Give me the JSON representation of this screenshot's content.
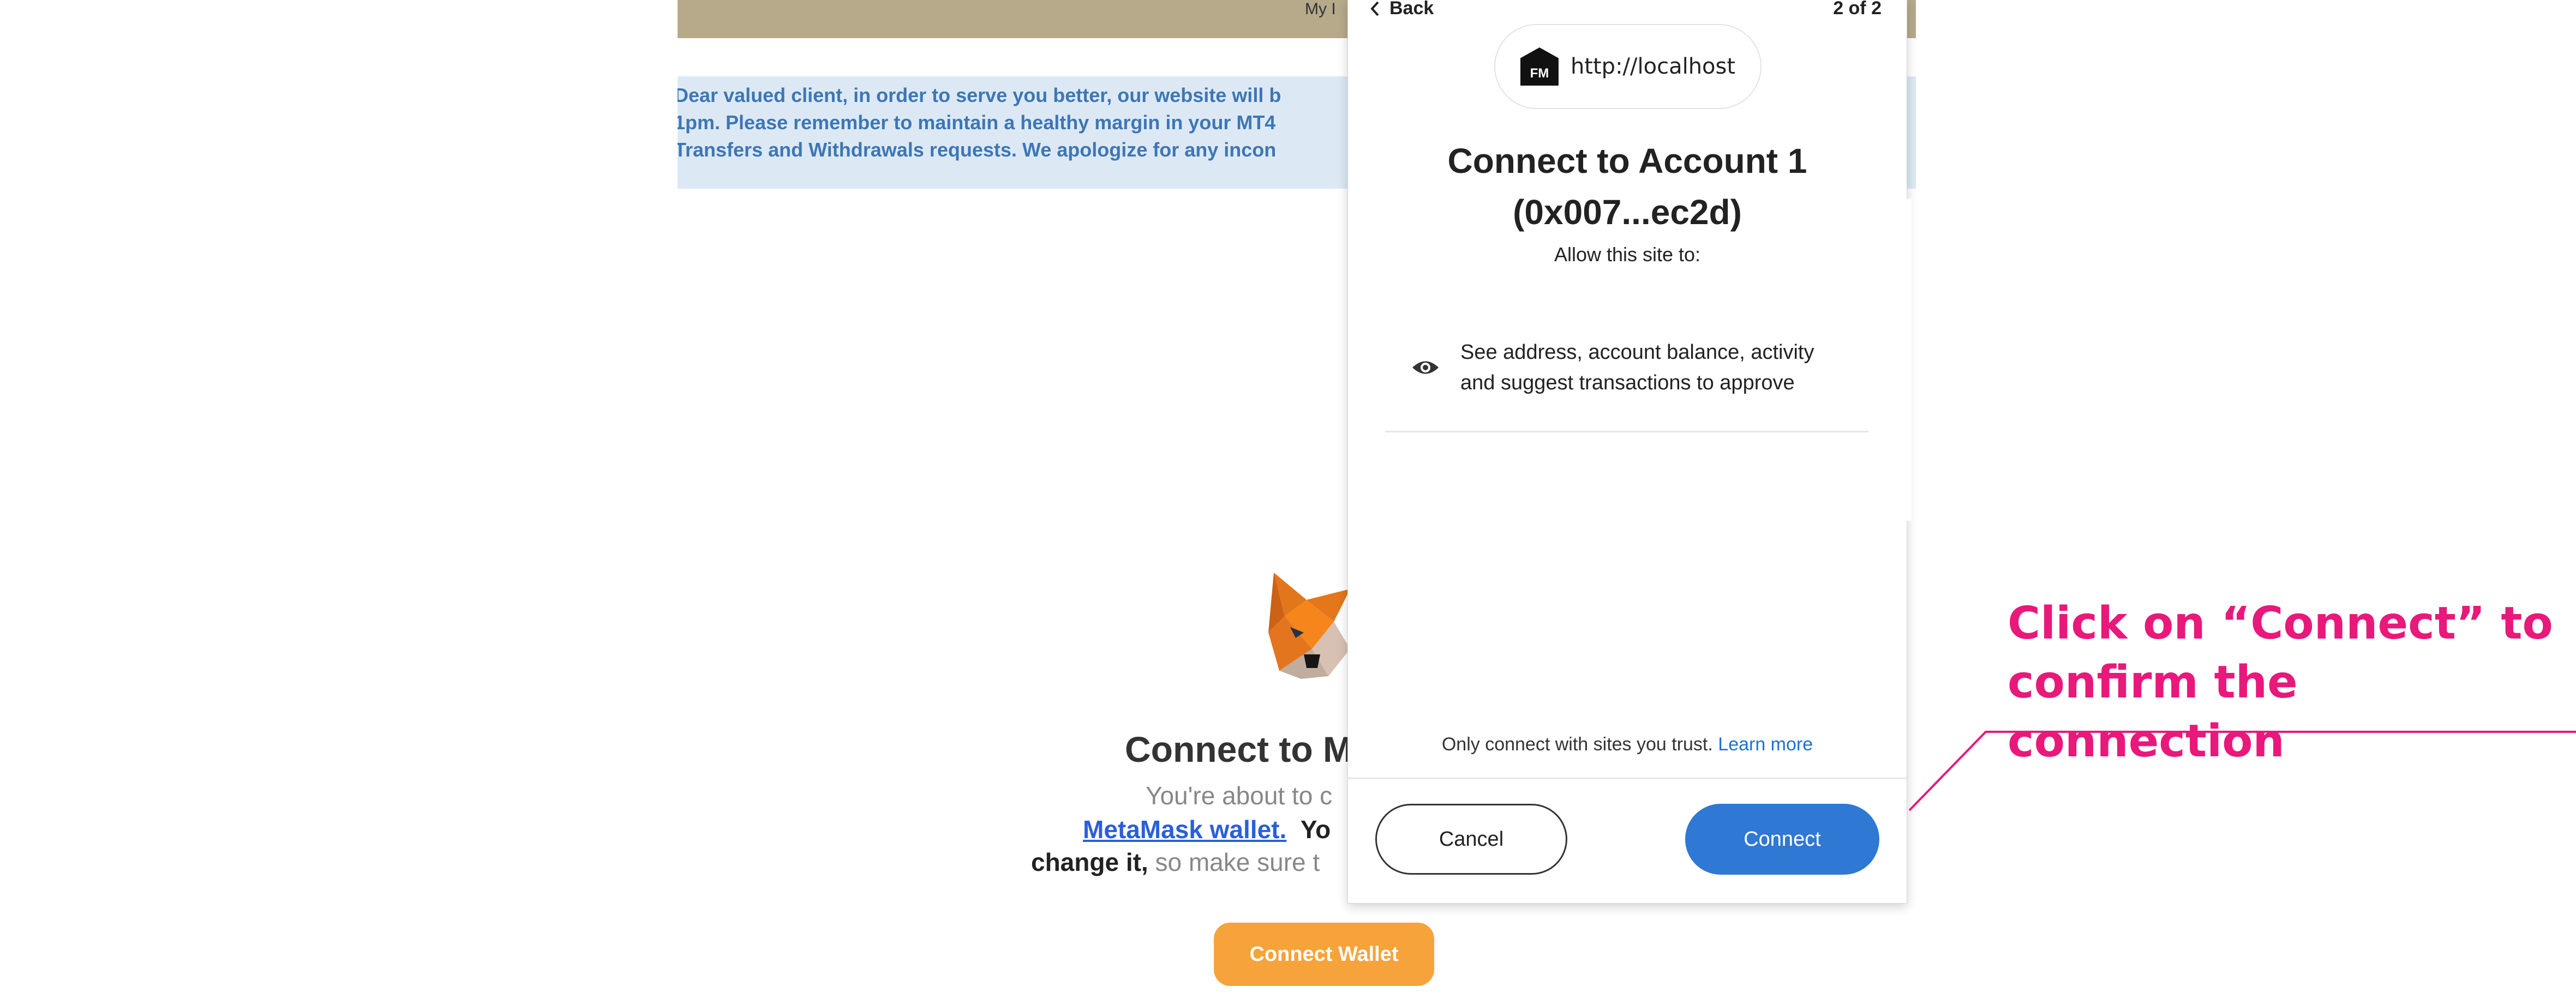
{
  "background_page": {
    "top_link": "My I",
    "notice_lines": [
      "Dear valued client, in order to serve you better, our website will b",
      "1pm. Please remember to maintain a healthy margin in your MT4",
      "Transfers and Withdrawals requests. We apologize for any incon"
    ],
    "heading": "Connect to M",
    "line1": "You're about to c",
    "line2_link": "MetaMask wallet.",
    "line2_bold": "Yo",
    "line3_bold": "change it,",
    "line3_rest": "so make sure t",
    "connect_wallet_label": "Connect Wallet"
  },
  "popup": {
    "back_label": "Back",
    "step": "2 of 2",
    "origin_badge": "FM",
    "origin_url": "http://localhost",
    "title_line1": "Connect to Account 1",
    "title_line2": "(0x007...ec2d)",
    "allow_text": "Allow this site to:",
    "permission_line1": "See address, account balance, activity",
    "permission_line2": "and suggest transactions to approve",
    "trust_text": "Only connect with sites you trust.",
    "learn_more": "Learn more",
    "cancel_label": "Cancel",
    "connect_label": "Connect"
  },
  "annotation": {
    "line1": "Click on “Connect” to",
    "line2": "confirm the connection",
    "color": "#e8197a"
  },
  "icons": [
    "metamask-fox-icon",
    "chevron-left-icon",
    "fm-logo-icon",
    "eye-icon"
  ]
}
